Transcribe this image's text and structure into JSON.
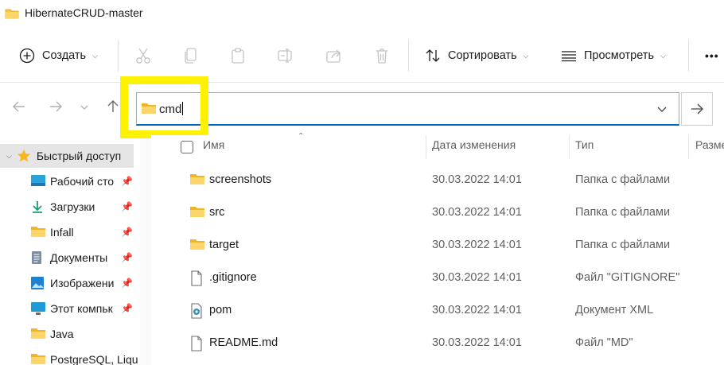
{
  "window": {
    "title": "HibernateCRUD-master"
  },
  "toolbar": {
    "create_label": "Создать",
    "sort_label": "Сортировать",
    "view_label": "Просмотреть",
    "more_label": "•••"
  },
  "address": {
    "value": "cmd"
  },
  "sidebar": {
    "items": [
      {
        "label": "Быстрый доступ",
        "icon": "star-icon",
        "pinned": false
      },
      {
        "label": "Рабочий сто",
        "icon": "desktop-icon",
        "pinned": true
      },
      {
        "label": "Загрузки",
        "icon": "download-icon",
        "pinned": true
      },
      {
        "label": "Infall",
        "icon": "folder-icon",
        "pinned": true
      },
      {
        "label": "Документы",
        "icon": "documents-icon",
        "pinned": true
      },
      {
        "label": "Изображени",
        "icon": "pictures-icon",
        "pinned": true
      },
      {
        "label": "Этот компьк",
        "icon": "computer-icon",
        "pinned": true
      },
      {
        "label": "Java",
        "icon": "folder-icon",
        "pinned": false
      },
      {
        "label": "PostgreSQL, Liqu",
        "icon": "folder-icon",
        "pinned": false
      }
    ]
  },
  "columns": {
    "name": "Имя",
    "date": "Дата изменения",
    "type": "Тип",
    "size": "Разме"
  },
  "files": [
    {
      "name": "screenshots",
      "date": "30.03.2022 14:01",
      "type": "Папка с файлами",
      "icon": "folder-icon"
    },
    {
      "name": "src",
      "date": "30.03.2022 14:01",
      "type": "Папка с файлами",
      "icon": "folder-icon"
    },
    {
      "name": "target",
      "date": "30.03.2022 14:01",
      "type": "Папка с файлами",
      "icon": "folder-icon"
    },
    {
      "name": ".gitignore",
      "date": "30.03.2022 14:01",
      "type": "Файл \"GITIGNORE\"",
      "icon": "file-icon"
    },
    {
      "name": "pom",
      "date": "30.03.2022 14:01",
      "type": "Документ XML",
      "icon": "xml-file-icon"
    },
    {
      "name": "README.md",
      "date": "30.03.2022 14:01",
      "type": "Файл \"MD\"",
      "icon": "file-icon"
    }
  ],
  "colors": {
    "highlight": "#fff200",
    "accent": "#0067c0",
    "folder": "#f8c545"
  }
}
